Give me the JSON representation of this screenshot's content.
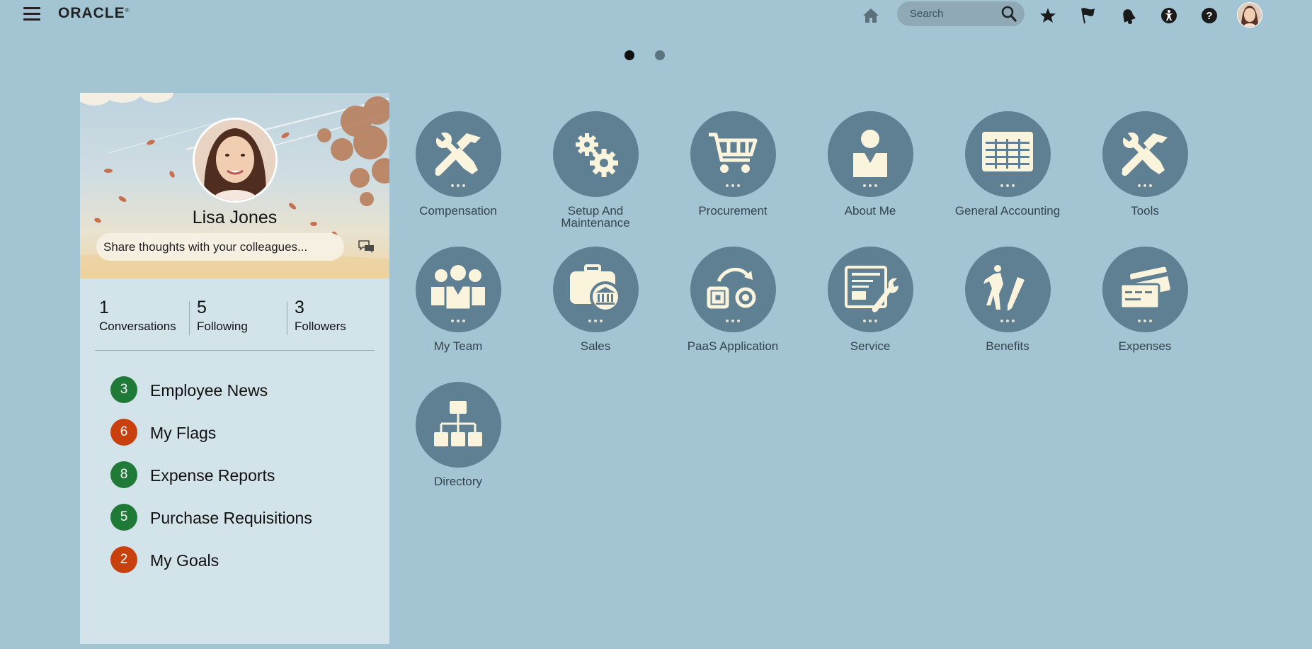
{
  "header": {
    "logo_text": "ORACLE",
    "logo_mark": "®",
    "search": {
      "placeholder": "Search"
    },
    "icons": [
      "home-icon",
      "search-icon",
      "favorites-star-icon",
      "watchlist-flag-icon",
      "notifications-bell-icon",
      "accessibility-icon",
      "help-icon"
    ]
  },
  "pager": {
    "pages": 2,
    "active_page": 1
  },
  "profile": {
    "name": "Lisa Jones",
    "share_placeholder": "Share thoughts with your colleagues...",
    "stats": [
      {
        "value": "1",
        "label": "Conversations"
      },
      {
        "value": "5",
        "label": "Following"
      },
      {
        "value": "3",
        "label": "Followers"
      }
    ],
    "worklist": [
      {
        "count": "3",
        "label": "Employee News",
        "color": "#1f7a38"
      },
      {
        "count": "6",
        "label": "My Flags",
        "color": "#c9400f"
      },
      {
        "count": "8",
        "label": "Expense Reports",
        "color": "#1f7a38"
      },
      {
        "count": "5",
        "label": "Purchase Requisitions",
        "color": "#1f7a38"
      },
      {
        "count": "2",
        "label": "My Goals",
        "color": "#c9400f"
      }
    ]
  },
  "apps": [
    {
      "label": "Compensation",
      "icon": "tools-icon"
    },
    {
      "label": "Setup And Maintenance",
      "icon": "gears-icon"
    },
    {
      "label": "Procurement",
      "icon": "cart-icon"
    },
    {
      "label": "About Me",
      "icon": "person-icon"
    },
    {
      "label": "General Accounting",
      "icon": "ledger-icon"
    },
    {
      "label": "Tools",
      "icon": "tools-icon"
    },
    {
      "label": "My Team",
      "icon": "team-icon"
    },
    {
      "label": "Sales",
      "icon": "sales-briefcase-icon"
    },
    {
      "label": "PaaS Application",
      "icon": "paas-icon"
    },
    {
      "label": "Service",
      "icon": "service-icon"
    },
    {
      "label": "Benefits",
      "icon": "benefits-icon"
    },
    {
      "label": "Expenses",
      "icon": "expenses-card-icon"
    },
    {
      "label": "Directory",
      "icon": "org-chart-icon"
    }
  ],
  "colors": {
    "background": "#a3c4d2",
    "tile": "#5f7f93",
    "tile_glyph": "#fbf4dc",
    "panel": "#d2e3ea"
  }
}
